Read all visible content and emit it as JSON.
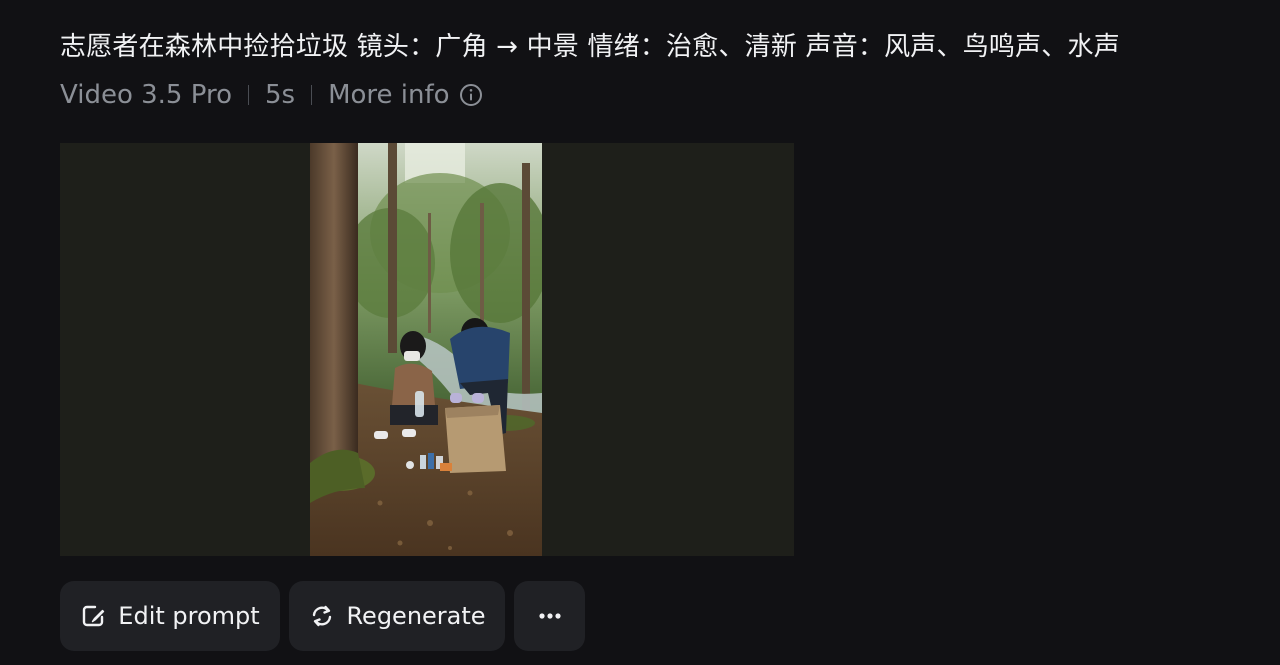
{
  "prompt": {
    "text": "志愿者在森林中捡拾垃圾 镜头：广角 → 中景 情绪：治愈、清新 声音：风声、鸟鸣声、水声"
  },
  "meta": {
    "model": "Video 3.5 Pro",
    "duration": "5s",
    "more_info_label": "More info",
    "info_icon": "info-circle-icon"
  },
  "video": {
    "description_icon": "video-thumbnail"
  },
  "actions": {
    "edit_prompt_label": "Edit prompt",
    "edit_prompt_icon": "edit-prompt-icon",
    "regenerate_label": "Regenerate",
    "regenerate_icon": "regenerate-icon",
    "more_icon": "more-dots-icon"
  },
  "colors": {
    "background": "#111114",
    "button_bg": "#202125",
    "muted_text": "#8b8f96",
    "video_letterbox": "#1e1f1a"
  }
}
